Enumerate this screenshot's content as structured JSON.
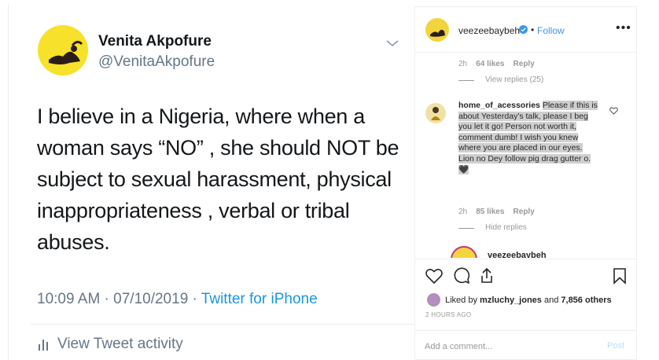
{
  "tweet": {
    "display_name": "Venita Akpofure",
    "handle": "@VenitaAkpofure",
    "text": "I believe in a Nigeria, where when a woman says “NO” , she should NOT be subject to sexual harassment, physical inappropriateness , verbal or tribal abuses.",
    "timestamp": "10:09 AM · 07/10/2019 · ",
    "source": "Twitter for iPhone",
    "activity_label": "View Tweet activity"
  },
  "instagram": {
    "header": {
      "username": "veezeebaybeh",
      "dot": "•",
      "follow_label": "Follow",
      "more_label": "•••"
    },
    "prev_comment": {
      "time": "2h",
      "likes": "64 likes",
      "reply_label": "Reply",
      "view_replies": "View replies (25)"
    },
    "comment": {
      "username": "home_of_acessories",
      "text": "Please if this is about Yesterday's talk, please I beg you let it go! Person not worth it, comment dumb! I wish you knew where you are placed in our eyes.",
      "text2": "Lion no Dey follow pig drag gutter o. 🖤",
      "time": "2h",
      "likes": "85 likes",
      "reply_label": "Reply",
      "hide_replies": "Hide replies"
    },
    "reply_peek": {
      "username": "veezeebaybeh"
    },
    "likes": {
      "prefix": "Liked by ",
      "user": "mzluchy_jones",
      "middle": " and ",
      "count": "7,856 others"
    },
    "post_time": "2 HOURS AGO",
    "comment_placeholder": "Add a comment...",
    "post_label": "Post",
    "colors": {
      "link_blue": "#3897f0",
      "twitter_blue": "#1b95e0",
      "highlight": "#cfcfcf"
    }
  }
}
